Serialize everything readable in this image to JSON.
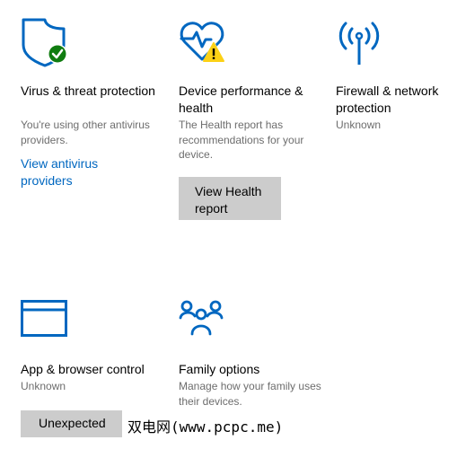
{
  "tiles": {
    "virus": {
      "icon": "shield-check-icon",
      "title": "Virus & threat protection",
      "description": "You're using other antivirus providers.",
      "link": "View antivirus providers"
    },
    "device": {
      "icon": "heart-warning-icon",
      "title": "Device performance & health",
      "description": "The Health report has recommendations for your device.",
      "button": "View Health report"
    },
    "firewall": {
      "icon": "antenna-icon",
      "title": "Firewall & network protection",
      "description": "Unknown"
    },
    "app_browser": {
      "icon": "app-window-icon",
      "title": "App & browser control",
      "description": "Unknown",
      "button": "Unexpected"
    },
    "family": {
      "icon": "family-icon",
      "title": "Family options",
      "description": "Manage how your family uses their devices."
    }
  },
  "watermark": "双电网(www.pcpc.me)",
  "colors": {
    "accent": "#0067c0",
    "success": "#107c10",
    "warning": "#fcd116",
    "button_bg": "#cccccc",
    "secondary_text": "#6d6d6d"
  }
}
